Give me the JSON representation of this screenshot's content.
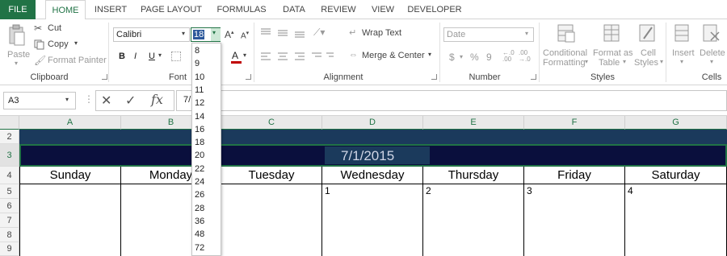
{
  "tabs": [
    "FILE",
    "HOME",
    "INSERT",
    "PAGE LAYOUT",
    "FORMULAS",
    "DATA",
    "REVIEW",
    "VIEW",
    "DEVELOPER"
  ],
  "ribbon": {
    "clipboard": {
      "paste": "Paste",
      "cut": "Cut",
      "copy": "Copy",
      "format_painter": "Format Painter",
      "label": "Clipboard"
    },
    "font": {
      "name": "Calibri",
      "size": "18",
      "bold": "B",
      "italic": "I",
      "underline": "U",
      "label": "Font"
    },
    "alignment": {
      "wrap": "Wrap Text",
      "merge": "Merge & Center",
      "label": "Alignment"
    },
    "number": {
      "format": "Date",
      "currency": "$",
      "percent": "%",
      "comma": "9",
      "label": "Number"
    },
    "styles": {
      "conditional": "Conditional",
      "conditional2": "Formatting",
      "format_as": "Format as",
      "format_as2": "Table",
      "cell": "Cell",
      "cell2": "Styles",
      "label": "Styles"
    },
    "cells": {
      "insert": "Insert",
      "delete": "Delete",
      "label": "Cells"
    }
  },
  "formula_bar": {
    "name_box": "A3",
    "fx": "fx",
    "value": "7/"
  },
  "columns": [
    "A",
    "B",
    "C",
    "D",
    "E",
    "F",
    "G"
  ],
  "rows": [
    "2",
    "3",
    "4",
    "5",
    "6",
    "7",
    "8",
    "9"
  ],
  "calendar": {
    "date_title": "7/1/2015",
    "days": [
      "Sunday",
      "Monday",
      "Tuesday",
      "Wednesday",
      "Thursday",
      "Friday",
      "Saturday"
    ],
    "first_row_numbers": [
      "",
      "",
      "",
      "1",
      "2",
      "3",
      "4"
    ]
  },
  "font_size_dropdown": [
    "8",
    "9",
    "10",
    "11",
    "12",
    "14",
    "16",
    "18",
    "20",
    "22",
    "24",
    "26",
    "28",
    "36",
    "48",
    "72"
  ],
  "colors": {
    "excel_green": "#217346",
    "title_band": "#1b3a5c",
    "title_dark": "#0a0f3d",
    "font_red": "#c00000"
  }
}
